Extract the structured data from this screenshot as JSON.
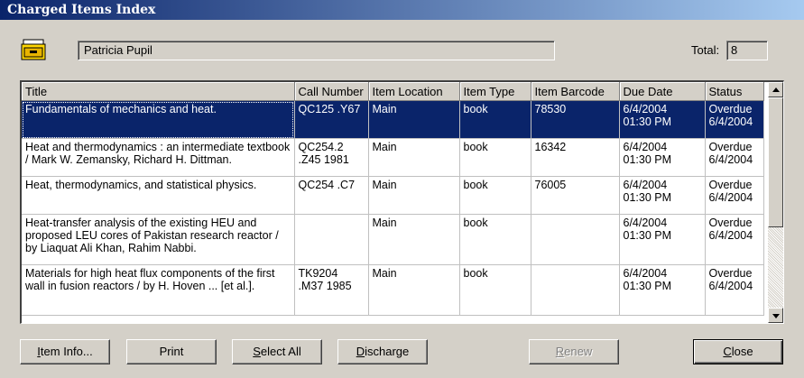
{
  "window": {
    "title": "Charged Items Index"
  },
  "patron": {
    "name": "Patricia Pupil",
    "total_label": "Total:",
    "total_value": "8"
  },
  "grid": {
    "columns": [
      "Title",
      "Call Number",
      "Item Location",
      "Item Type",
      "Item Barcode",
      "Due Date",
      "Status"
    ],
    "rows": [
      {
        "title": "Fundamentals of mechanics and heat.",
        "call_number": "QC125 .Y67",
        "location": "Main",
        "type": "book",
        "barcode": "78530",
        "due_date": "6/4/2004",
        "due_time": "01:30 PM",
        "status": "Overdue",
        "status_date": "6/4/2004"
      },
      {
        "title": "Heat and thermodynamics : an intermediate textbook / Mark W. Zemansky, Richard H. Dittman.",
        "call_number": "QC254.2 .Z45 1981",
        "location": "Main",
        "type": "book",
        "barcode": "16342",
        "due_date": "6/4/2004",
        "due_time": "01:30 PM",
        "status": "Overdue",
        "status_date": "6/4/2004"
      },
      {
        "title": "Heat, thermodynamics, and statistical physics.",
        "call_number": "QC254 .C7",
        "location": "Main",
        "type": "book",
        "barcode": "76005",
        "due_date": "6/4/2004",
        "due_time": "01:30 PM",
        "status": "Overdue",
        "status_date": "6/4/2004"
      },
      {
        "title": "Heat-transfer analysis of the existing HEU and proposed LEU cores of Pakistan research reactor / by Liaquat Ali Khan, Rahim Nabbi.",
        "call_number": "",
        "location": "Main",
        "type": "book",
        "barcode": "",
        "due_date": "6/4/2004",
        "due_time": "01:30 PM",
        "status": "Overdue",
        "status_date": "6/4/2004"
      },
      {
        "title": "Materials for high heat flux components of the first wall in fusion reactors / by H. Hoven ... [et al.].",
        "call_number": "TK9204 .M37 1985",
        "location": "Main",
        "type": "book",
        "barcode": "",
        "due_date": "6/4/2004",
        "due_time": "01:30 PM",
        "status": "Overdue",
        "status_date": "6/4/2004"
      }
    ]
  },
  "buttons": {
    "item_info": {
      "key": "I",
      "rest": "tem Info..."
    },
    "print": {
      "key": "",
      "rest": "Print"
    },
    "select_all": {
      "key": "S",
      "rest": "elect All"
    },
    "discharge": {
      "key": "D",
      "rest": "ischarge"
    },
    "renew": {
      "key": "R",
      "rest": "enew"
    },
    "close": {
      "key": "C",
      "rest": "lose"
    }
  },
  "icons": {
    "patron": "file-drawer-icon",
    "scroll_up": "arrow-up-icon",
    "scroll_down": "arrow-down-icon"
  },
  "colors": {
    "selection": "#0a246a",
    "face": "#d4d0c8"
  }
}
